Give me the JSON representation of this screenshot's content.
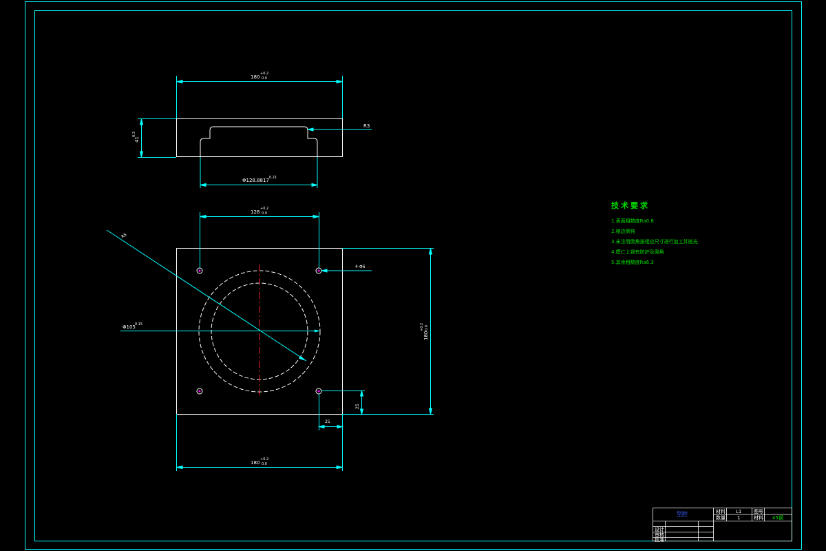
{
  "drawing": {
    "colors": {
      "frame": "#00ffff",
      "outline": "#ffffff",
      "dimension": "#00ffff",
      "centerline": "#ff2020",
      "text_green": "#00e000",
      "hole_marker": "#ff00ff",
      "title_blue": "#3a5cff"
    },
    "top_view": {
      "width_dim": "180",
      "width_tol_upper": "+0.2",
      "width_tol_lower": "0.0",
      "height_dim": "41",
      "height_tol": "0.3",
      "radius_label": "R3",
      "bore_dim": "Φ128.8817",
      "bore_tol": "0.21"
    },
    "plan_view": {
      "hole_spacing_dim": "128",
      "hole_spacing_tol_upper": "+0.2",
      "hole_spacing_tol_lower": "0.0",
      "hole_label": "4-Φ6",
      "circle_dia_dim": "Φ105",
      "circle_dia_tol": "0.15",
      "leader_label": "R5",
      "height_dim": "180",
      "height_tol_upper": "+0.2",
      "height_tol_lower": "0.0",
      "edge_offset_y_dim": "25",
      "edge_offset_x_dim": "25",
      "bottom_width_dim": "180",
      "bottom_width_tol_upper": "+0.2",
      "bottom_width_tol_lower": "0.0"
    }
  },
  "tech_requirements": {
    "title": "技术要求",
    "items": [
      "1.表面粗糙度Ra0.8",
      "2.棱边倒钝",
      "3.未注明倒角按相应尺寸进行加工并抛光",
      "4.模仁上锁有防护及倒角",
      "5.其余粗糙度Ra6.3"
    ]
  },
  "title_block": {
    "part_name": "型腔",
    "label_material": "材料",
    "value_material_code": "L1",
    "label_quantity": "数量",
    "value_quantity": "1",
    "label_drawing_no": "图号",
    "label_stock": "材料",
    "value_stock": "45钢",
    "label_design": "设计",
    "label_check": "审核",
    "label_approve": "批准"
  }
}
